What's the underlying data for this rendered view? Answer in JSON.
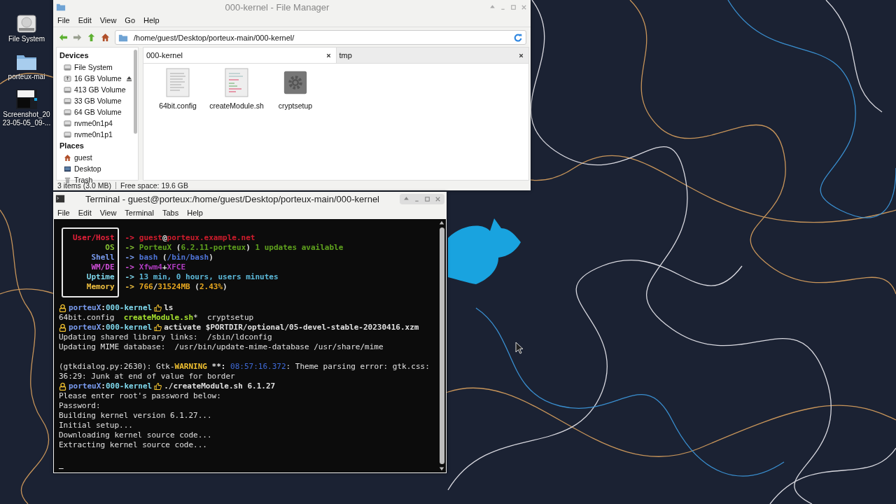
{
  "desktop_icons": [
    {
      "kind": "drive",
      "lines": [
        "File System"
      ]
    },
    {
      "kind": "folder",
      "lines": [
        "porteux-mai"
      ]
    },
    {
      "kind": "screenshot",
      "lines": [
        "Screenshot_20",
        "23-05-05_09-..."
      ]
    }
  ],
  "file_manager": {
    "title": "000-kernel - File Manager",
    "menu": [
      "File",
      "Edit",
      "View",
      "Go",
      "Help"
    ],
    "path": "/home/guest/Desktop/porteux-main/000-kernel/",
    "sections": [
      {
        "heading": "Devices",
        "items": [
          {
            "label": "File System",
            "kind": "drive",
            "eject": false
          },
          {
            "label": "16 GB Volume",
            "kind": "usb",
            "eject": true
          },
          {
            "label": "413 GB Volume",
            "kind": "drive",
            "eject": false
          },
          {
            "label": "33 GB Volume",
            "kind": "drive",
            "eject": false
          },
          {
            "label": "64 GB Volume",
            "kind": "drive",
            "eject": false
          },
          {
            "label": "nvme0n1p4",
            "kind": "drive",
            "eject": false
          },
          {
            "label": "nvme0n1p1",
            "kind": "drive",
            "eject": false
          }
        ]
      },
      {
        "heading": "Places",
        "items": [
          {
            "label": "guest",
            "kind": "home",
            "eject": false
          },
          {
            "label": "Desktop",
            "kind": "desktop",
            "eject": false
          },
          {
            "label": "Trash",
            "kind": "trash",
            "eject": false
          }
        ]
      }
    ],
    "tabs": [
      {
        "label": "000-kernel",
        "selected": true
      },
      {
        "label": "tmp",
        "selected": false
      }
    ],
    "files": [
      {
        "name": "64bit.config",
        "kind": "text"
      },
      {
        "name": "createModule.sh",
        "kind": "script"
      },
      {
        "name": "cryptsetup",
        "kind": "binary"
      }
    ],
    "status": [
      "3 items (3.0 MB)",
      "Free space: 19.6 GB"
    ]
  },
  "terminal": {
    "title": "Terminal - guest@porteux:/home/guest/Desktop/porteux-main/000-kernel",
    "menu": [
      "File",
      "Edit",
      "View",
      "Terminal",
      "Tabs",
      "Help"
    ],
    "fetch": [
      {
        "key": "User/Host",
        "arrow": "->",
        "color": "#e8203a",
        "value": [
          {
            "text": "guest",
            "color": "#d01c2c"
          },
          {
            "text": "@",
            "color": "#e0e0e0"
          },
          {
            "text": "porteux.example.net",
            "color": "#d01c2c"
          }
        ]
      },
      {
        "key": "OS",
        "arrow": "->",
        "color": "#86c232",
        "value": [
          {
            "text": "PorteuX",
            "color": "#5fa21e"
          },
          {
            "text": " (",
            "color": "#e0e0e0"
          },
          {
            "text": "6.2.11-porteux",
            "color": "#5fa21e"
          },
          {
            "text": ") ",
            "color": "#e0e0e0"
          },
          {
            "text": "1 updates available",
            "color": "#5fa21e"
          }
        ]
      },
      {
        "key": "Shell",
        "arrow": "->",
        "color": "#7a9cf0",
        "value": [
          {
            "text": "bash",
            "color": "#4f74d8"
          },
          {
            "text": " (",
            "color": "#e0e0e0"
          },
          {
            "text": "/bin/bash",
            "color": "#4f74d8"
          },
          {
            "text": ")",
            "color": "#e0e0e0"
          }
        ]
      },
      {
        "key": "WM/DE",
        "arrow": "->",
        "color": "#d04ed8",
        "value": [
          {
            "text": "Xfwm4",
            "color": "#b03cc0"
          },
          {
            "text": "+",
            "color": "#e0e0e0"
          },
          {
            "text": "XFCE",
            "color": "#b03cc0"
          }
        ]
      },
      {
        "key": "Uptime",
        "arrow": "->",
        "color": "#7fd8ec",
        "value": [
          {
            "text": "13 min, 0 hours, users minutes",
            "color": "#5cb8d8"
          }
        ]
      },
      {
        "key": "Memory",
        "arrow": "->",
        "color": "#f0c040",
        "value": [
          {
            "text": "766",
            "color": "#e8a820"
          },
          {
            "text": "/",
            "color": "#e0e0e0"
          },
          {
            "text": "31524MB",
            "color": "#e8a820"
          },
          {
            "text": " (",
            "color": "#e0e0e0"
          },
          {
            "text": "2.43%",
            "color": "#e8a820"
          },
          {
            "text": ")",
            "color": "#e0e0e0"
          }
        ]
      }
    ],
    "lines": [
      {
        "kind": "prompt",
        "user": "porteuX",
        "sep": ":",
        "dir": "000-kernel",
        "command": "ls"
      },
      {
        "kind": "text",
        "segments": [
          {
            "text": "64bit.config  ",
            "color": "#e0e0e0",
            "bold": false
          },
          {
            "text": "createModule.sh",
            "color": "#a6e22e",
            "bold": true
          },
          {
            "text": "*  cryptsetup",
            "color": "#e0e0e0",
            "bold": false
          }
        ]
      },
      {
        "kind": "prompt",
        "user": "porteuX",
        "sep": ":",
        "dir": "000-kernel",
        "command": "activate $PORTDIR/optional/05-devel-stable-20230416.xzm"
      },
      {
        "kind": "text",
        "segments": [
          {
            "text": "Updating shared library links:  /sbin/ldconfig",
            "color": "#e0e0e0",
            "bold": false
          }
        ]
      },
      {
        "kind": "text",
        "segments": [
          {
            "text": "Updating MIME database:  /usr/bin/update-mime-database /usr/share/mime",
            "color": "#e0e0e0",
            "bold": false
          }
        ]
      },
      {
        "kind": "blank"
      },
      {
        "kind": "text",
        "segments": [
          {
            "text": "(gtkdialog.py:2630): Gtk-",
            "color": "#e0e0e0",
            "bold": false
          },
          {
            "text": "WARNING",
            "color": "#f0c030",
            "bold": true
          },
          {
            "text": " **: ",
            "color": "#e0e0e0",
            "bold": true
          },
          {
            "text": "08:57:16.372",
            "color": "#3f6ad8",
            "bold": false
          },
          {
            "text": ": Theme parsing error: gtk.css:",
            "color": "#e0e0e0",
            "bold": false
          }
        ]
      },
      {
        "kind": "text",
        "segments": [
          {
            "text": "36:29: Junk at end of value for border",
            "color": "#e0e0e0",
            "bold": false
          }
        ]
      },
      {
        "kind": "prompt",
        "user": "porteuX",
        "sep": ":",
        "dir": "000-kernel",
        "command": "./createModule.sh 6.1.27"
      },
      {
        "kind": "text",
        "segments": [
          {
            "text": "Please enter root's password below:",
            "color": "#e0e0e0",
            "bold": false
          }
        ]
      },
      {
        "kind": "text",
        "segments": [
          {
            "text": "Password:",
            "color": "#e0e0e0",
            "bold": false
          }
        ]
      },
      {
        "kind": "text",
        "segments": [
          {
            "text": "Building kernel version 6.1.27...",
            "color": "#e0e0e0",
            "bold": false
          }
        ]
      },
      {
        "kind": "text",
        "segments": [
          {
            "text": "Initial setup...",
            "color": "#e0e0e0",
            "bold": false
          }
        ]
      },
      {
        "kind": "text",
        "segments": [
          {
            "text": "Downloading kernel source code...",
            "color": "#e0e0e0",
            "bold": false
          }
        ]
      },
      {
        "kind": "text",
        "segments": [
          {
            "text": "Extracting kernel source code...",
            "color": "#e0e0e0",
            "bold": false
          }
        ]
      },
      {
        "kind": "blank"
      },
      {
        "kind": "text",
        "segments": [
          {
            "text": "_",
            "color": "#e0e0e0",
            "bold": true
          }
        ]
      }
    ]
  }
}
